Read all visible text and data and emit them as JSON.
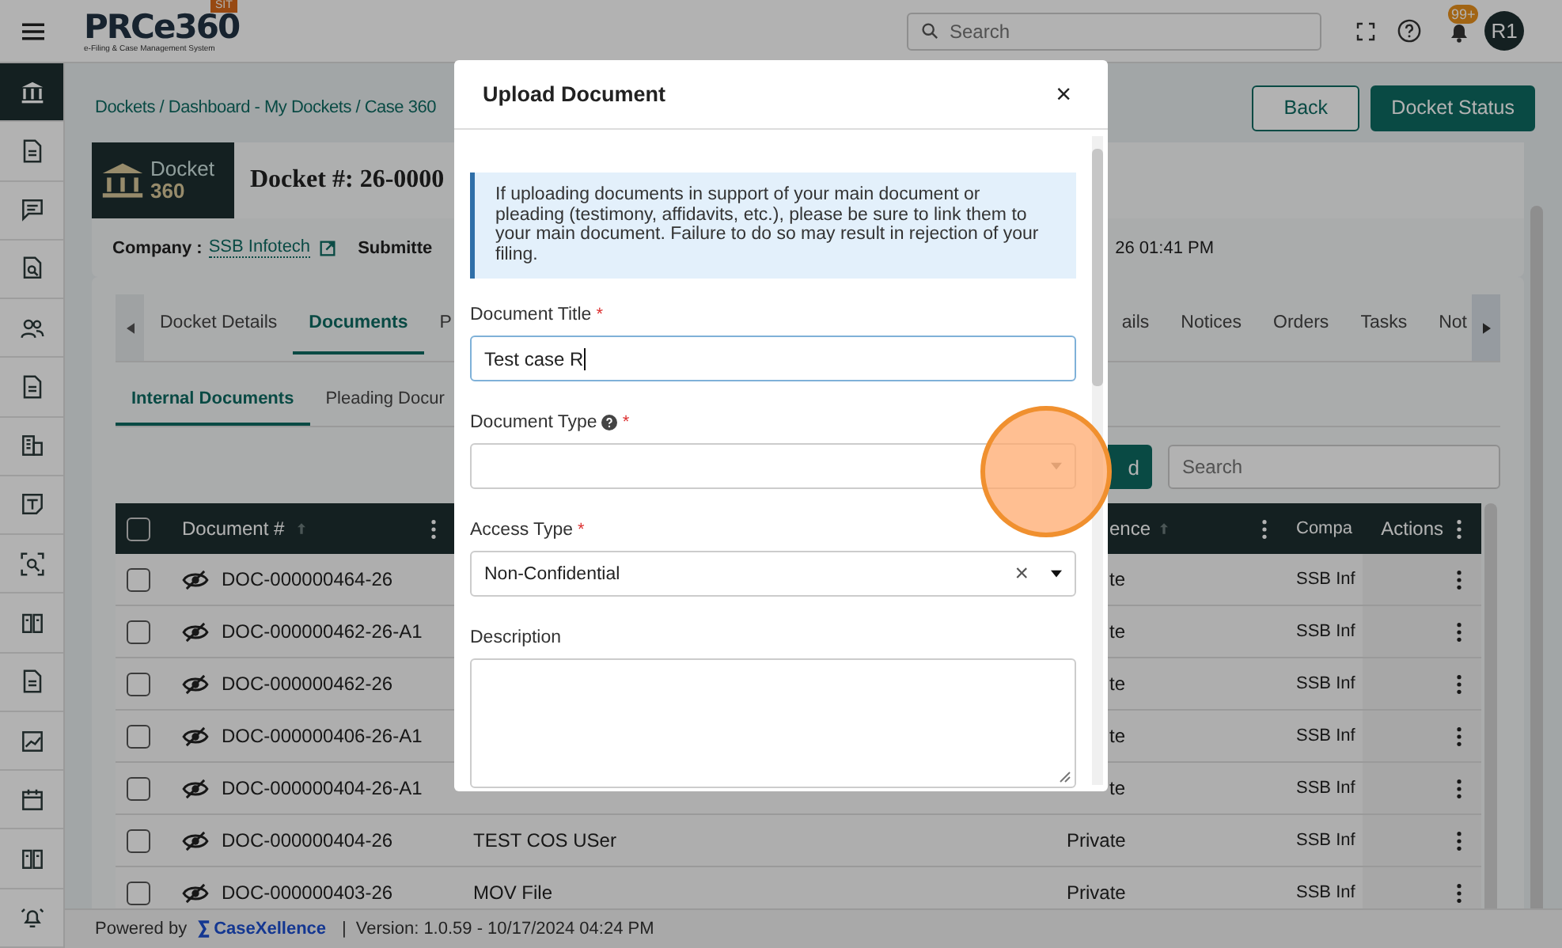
{
  "header": {
    "logo": "PRCe360",
    "logo_subtitle": "e-Filing & Case Management System",
    "env_badge": "SIT",
    "search": {
      "placeholder": "Search"
    },
    "notification_count": "99+",
    "avatar": "R1"
  },
  "sidebar": {
    "items": [
      {
        "selected": true
      },
      {
        "selected": false
      },
      {
        "selected": false
      },
      {
        "selected": false
      },
      {
        "selected": false
      },
      {
        "selected": false
      },
      {
        "selected": false
      },
      {
        "selected": false
      },
      {
        "selected": false
      },
      {
        "selected": false
      },
      {
        "selected": false
      },
      {
        "selected": false
      },
      {
        "selected": false
      },
      {
        "selected": false
      },
      {
        "selected": false
      }
    ]
  },
  "breadcrumb": "Dockets / Dashboard - My Dockets / Case 360",
  "buttons": [
    "Back",
    "Docket Status"
  ],
  "docket": {
    "badge_title": "Docket",
    "badge_number": "360",
    "title": "Docket #: 26-0000",
    "company_label": "Company :",
    "company": "SSB Infotech",
    "submitted_label": "Submitte",
    "submitted_value": "26 01:41 PM"
  },
  "tabs": [
    {
      "label": "Docket Details",
      "selected": false
    },
    {
      "label": "Documents",
      "selected": true
    },
    {
      "label": "P",
      "selected": false
    },
    {
      "label": "ails",
      "selected": false
    },
    {
      "label": "Notices",
      "selected": false
    },
    {
      "label": "Orders",
      "selected": false
    },
    {
      "label": "Tasks",
      "selected": false
    },
    {
      "label": "Not",
      "selected": false
    }
  ],
  "subtabs": [
    {
      "label": "Internal Documents",
      "selected": true
    },
    {
      "label": "Pleading Docur",
      "selected": false
    }
  ],
  "add_button": "d",
  "table_search": {
    "placeholder": "Search"
  },
  "table": {
    "header_checked": false,
    "columns": {
      "document": "Document #",
      "column_4": "ence",
      "company": "Compa",
      "actions": "Actions"
    },
    "rows": [
      {
        "checked": false,
        "document": "DOC-000000464-26",
        "column_4": "te",
        "company": "SSB Inf"
      },
      {
        "checked": false,
        "document": "DOC-000000462-26-A1",
        "column_4": "te",
        "company": "SSB Inf"
      },
      {
        "checked": false,
        "document": "DOC-000000462-26",
        "column_4": "te",
        "company": "SSB Inf"
      },
      {
        "checked": false,
        "document": "DOC-000000406-26-A1",
        "column_4": "te",
        "company": "SSB Inf"
      },
      {
        "checked": false,
        "document": "DOC-000000404-26-A1",
        "column_4": "te",
        "company": "SSB Inf"
      },
      {
        "checked": false,
        "document": "DOC-000000404-26",
        "title": "TEST COS USer",
        "column_4": "Private",
        "company": "SSB Inf"
      },
      {
        "checked": false,
        "document": "DOC-000000403-26",
        "title": "MOV File",
        "column_4": "Private",
        "company": "SSB Inf"
      }
    ]
  },
  "footer": {
    "powered_by": "Powered by",
    "brand": "CaseXellence",
    "separator": "|",
    "version": "Version: 1.0.59 - 10/17/2024 04:24 PM"
  },
  "modal": {
    "title": "Upload Document",
    "close": "×",
    "notice": "If uploading documents in support of your main document or pleading (testimony, affidavits, etc.), please be sure to link them to your main document. Failure to do so may result in rejection of your filing.",
    "fields": [
      {
        "kind": "text",
        "label": "Document Title",
        "required_mark": "*",
        "value": "Test case R"
      },
      {
        "kind": "select",
        "label": "Document Type",
        "help": true,
        "required_mark": "*"
      },
      {
        "kind": "select",
        "label": "Access Type",
        "required_mark": "*",
        "value": "Non-Confidential",
        "clear": "×"
      },
      {
        "kind": "textarea",
        "label": "Description"
      }
    ]
  }
}
